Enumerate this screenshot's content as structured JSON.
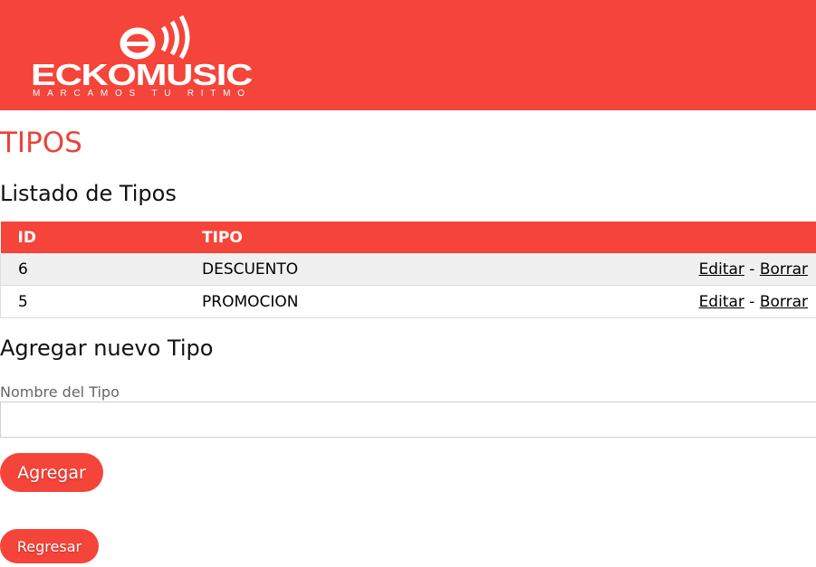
{
  "header": {
    "logo_text": "ECKOMUSIC",
    "logo_tagline": "MARCAMOS TU RITMO",
    "brand_color": "#f5443a"
  },
  "page_title": "TIPOS",
  "list_title": "Listado de Tipos",
  "table": {
    "headers": {
      "id": "ID",
      "tipo": "TIPO"
    },
    "rows": [
      {
        "id": "6",
        "tipo": "DESCUENTO",
        "edit": "Editar",
        "sep": "-",
        "delete": "Borrar"
      },
      {
        "id": "5",
        "tipo": "PROMOCION",
        "edit": "Editar",
        "sep": "-",
        "delete": "Borrar"
      }
    ]
  },
  "form": {
    "title": "Agregar nuevo Tipo",
    "label": "Nombre del Tipo",
    "value": "",
    "placeholder": "",
    "submit_label": "Agregar"
  },
  "back_label": "Regresar"
}
